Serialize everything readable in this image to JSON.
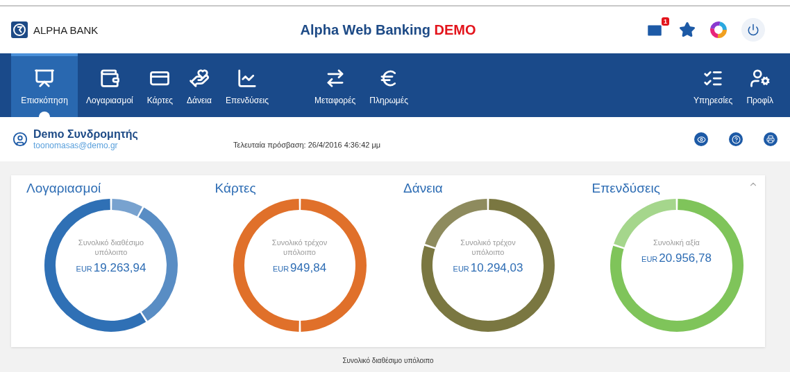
{
  "header": {
    "logo_text": "ALPHA BANK",
    "title": "Alpha Web Banking",
    "title_badge": "DEMO",
    "mail_count": "1"
  },
  "nav": {
    "groups": [
      {
        "items": [
          {
            "label": "Επισκόπηση",
            "selected": true
          },
          {
            "label": "Λογαριασμοί",
            "selected": false
          },
          {
            "label": "Κάρτες",
            "selected": false
          },
          {
            "label": "Δάνεια",
            "selected": false
          },
          {
            "label": "Επενδύσεις",
            "selected": false
          }
        ]
      },
      {
        "items": [
          {
            "label": "Μεταφορές",
            "selected": false
          },
          {
            "label": "Πληρωμές",
            "selected": false
          }
        ]
      },
      {
        "items": [
          {
            "label": "Υπηρεσίες",
            "selected": false
          },
          {
            "label": "Προφίλ",
            "selected": false
          }
        ]
      }
    ]
  },
  "user": {
    "name": "Demo Συνδρομητής",
    "email": "toonomasas@demo.gr",
    "last_login": "Τελευταία πρόσβαση: 26/4/2016 4:36:42 μμ"
  },
  "summary": {
    "cards": [
      {
        "title": "Λογαριασμοί",
        "label": "Συνολικό διαθέσιμο υπόλοιπο",
        "currency": "EUR",
        "amount": "19.263,94",
        "color": "#2f70b5"
      },
      {
        "title": "Κάρτες",
        "label": "Συνολικό τρέχον υπόλοιπο",
        "currency": "EUR",
        "amount": "949,84",
        "color": "#e0702a"
      },
      {
        "title": "Δάνεια",
        "label": "Συνολικό τρέχον υπόλοιπο",
        "currency": "EUR",
        "amount": "10.294,03",
        "color": "#7a7741"
      },
      {
        "title": "Επενδύσεις",
        "label": "Συνολική αξία",
        "currency": "EUR",
        "amount": "20.956,78",
        "color": "#7fc45a"
      }
    ]
  },
  "bottom_caption": "Συνολικό διαθέσιμο υπόλοιπο"
}
